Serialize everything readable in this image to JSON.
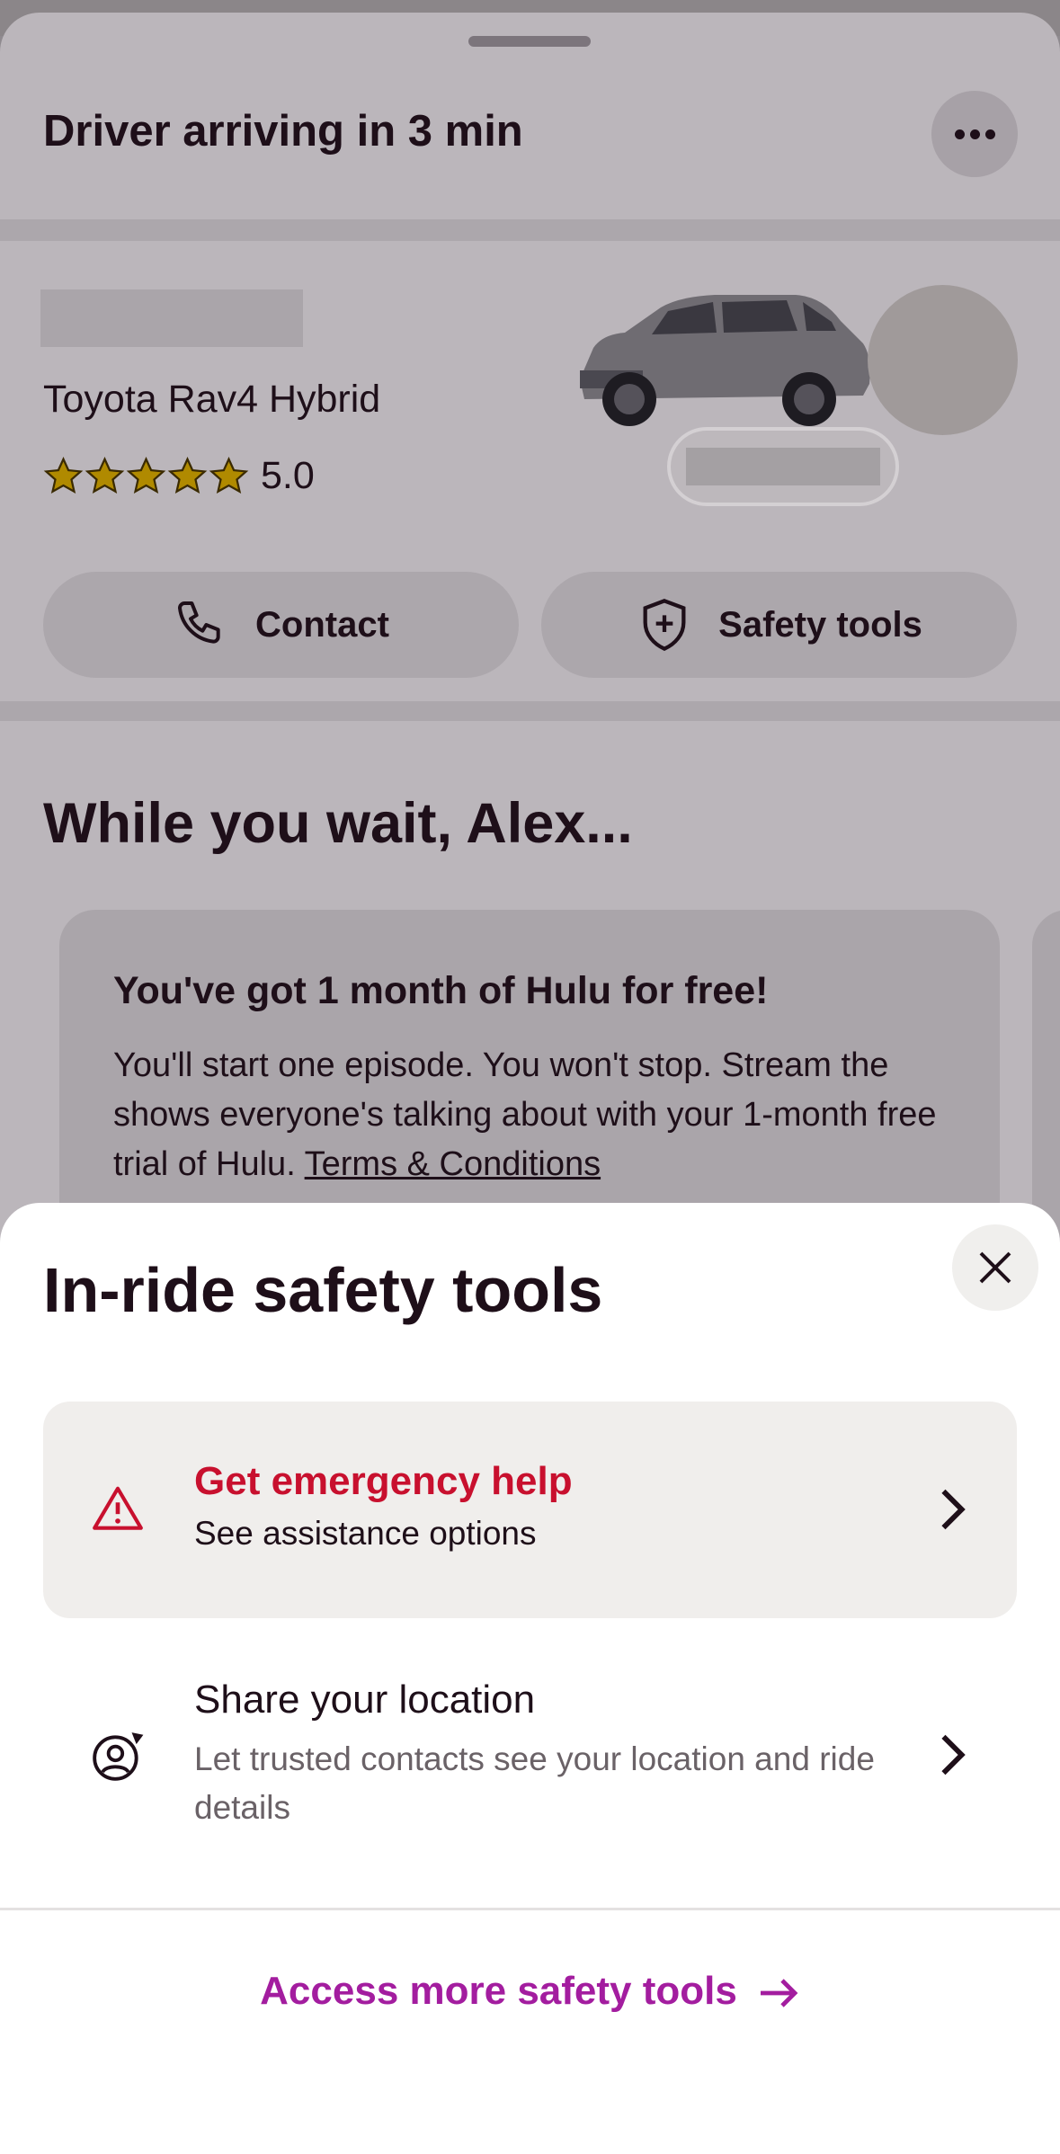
{
  "header": {
    "title": "Driver arriving in 3 min"
  },
  "vehicle": {
    "model": "Toyota Rav4 Hybrid",
    "rating": "5.0",
    "stars": 5
  },
  "actions": {
    "contact_label": "Contact",
    "safety_label": "Safety tools"
  },
  "promo": {
    "section_title": "While you wait, Alex...",
    "title": "You've got 1 month of Hulu for free!",
    "body": "You'll start one episode. You won't stop. Stream the shows everyone's talking about with your 1-month free trial of Hulu. ",
    "link": "Terms & Conditions"
  },
  "safety_modal": {
    "title": "In-ride safety tools",
    "emergency": {
      "title": "Get emergency help",
      "subtitle": "See assistance options"
    },
    "location": {
      "title": "Share your location",
      "subtitle": "Let trusted contacts see your location and ride details"
    },
    "access_more": "Access more safety tools"
  },
  "colors": {
    "emergency_red": "#c8102e",
    "brand_magenta": "#a31d9f",
    "text_dark": "#1e0f19"
  }
}
